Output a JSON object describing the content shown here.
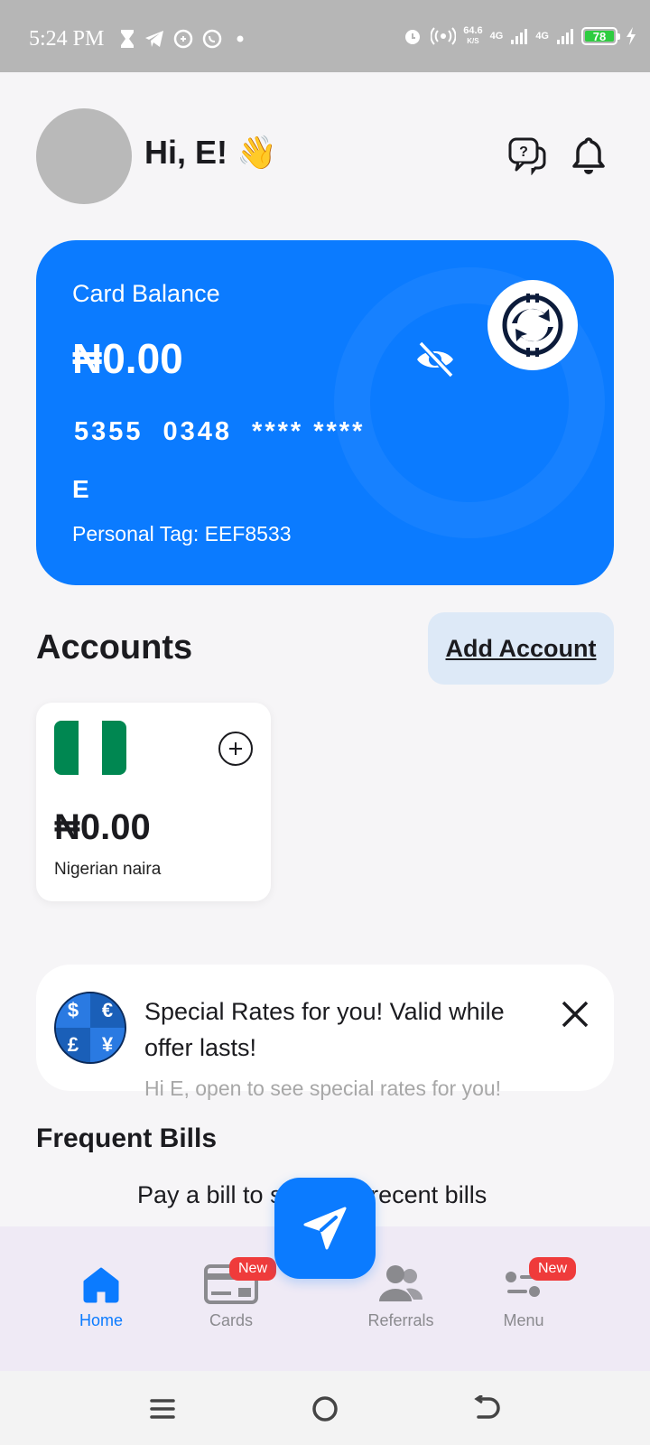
{
  "status_bar": {
    "time": "5:24 PM",
    "speed_value": "64.6",
    "speed_unit": "K/S",
    "net1": "4G",
    "net2": "4G",
    "battery": "78",
    "icons": [
      "hourglass-icon",
      "telegram-icon",
      "whatsapp-business-icon",
      "whatsapp-icon",
      "dot-icon",
      "alarm-icon",
      "hotspot-icon",
      "signal-icon",
      "battery-icon",
      "charging-icon"
    ]
  },
  "header": {
    "greeting": "Hi, E!",
    "wave": "👋"
  },
  "card": {
    "label": "Card Balance",
    "balance": "₦0.00",
    "number_parts": [
      "5355",
      "0348",
      "**** ****"
    ],
    "holder": "E",
    "tag": "Personal Tag: EEF8533"
  },
  "accounts": {
    "title": "Accounts",
    "add_button": "Add Account",
    "items": [
      {
        "balance": "₦0.00",
        "currency": "Nigerian naira"
      }
    ]
  },
  "promo": {
    "title": " Special Rates for you! Valid while offer lasts!",
    "subtitle": "Hi E, open to see special rates for you!",
    "currency_symbols": [
      "$",
      "€",
      "£",
      "¥"
    ]
  },
  "bills": {
    "title": "Frequent Bills",
    "empty_text": "Pay a bill to see your recent bills"
  },
  "nav": {
    "items": [
      {
        "label": "Home",
        "active": true
      },
      {
        "label": "Cards",
        "badge": "New"
      },
      {
        "label": "Referrals"
      },
      {
        "label": "Menu",
        "badge": "New"
      }
    ]
  },
  "colors": {
    "primary": "#0b7bff",
    "badge": "#ef3b3b",
    "nigeria_green": "#008751"
  }
}
